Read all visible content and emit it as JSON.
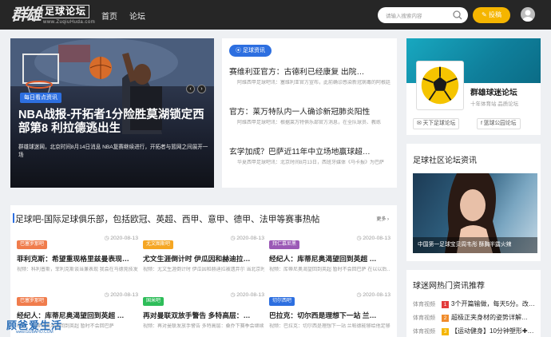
{
  "header": {
    "logo_big": "群雄",
    "logo_box": "足球论坛",
    "logo_sub": "www.ZuqiuHuda.com",
    "nav": [
      "首页",
      "论坛"
    ],
    "search_placeholder": "请输入搜索内容",
    "contribute": "投稿"
  },
  "hero": {
    "tag": "每日看点资讯",
    "title": "NBA战报-开拓者1分险胜莫湖锁定西部第8 利拉德逃出生",
    "caption": "群雄球迷网，北京时间8月14日消息 NBA复赛继续进行，开拓者与篮网之间展开一场",
    "prev": "‹",
    "next": "›"
  },
  "news": {
    "pill": "足球资讯",
    "items": [
      {
        "title": "赛维利亚官方：古德利已经康复 出院…",
        "desc": "阿维西甲足球吧讯：塞维利亚官方宣布，此前确诊感染新冠病毒的阿根廷"
      },
      {
        "title": "官方：莱万特队内一人确诊新冠肺炎阳性",
        "desc": "阿维西甲足球吧讯：根据莱万特俱乐部官方消息，在全队球员、教练"
      },
      {
        "title": "玄学加成？巴萨近11年中立场地赢球超…",
        "desc": "华夏西甲足球吧讯：北京时间8月13日，西班牙媒体《马卡报》为巴萨"
      }
    ]
  },
  "forum": {
    "name": "群雄球迷论坛",
    "sub": "十年体育站 品质论坛",
    "btn1": "天下足球论坛",
    "btn2": "篮球公园论坛"
  },
  "community": {
    "heading": "足球社区论坛资讯",
    "caption": "中国第一足球宝贝周韦彤 酥胸半露火辣"
  },
  "hot": {
    "heading": "球迷网热门资讯推荐",
    "rows": [
      {
        "cat": "体育视频",
        "num": "1",
        "text": "3个开篇输做，每天5分。改…"
      },
      {
        "cat": "体育视频",
        "num": "2",
        "text": "超极正夹身材的姿势详解…"
      },
      {
        "cat": "体育视频",
        "num": "3",
        "text": "【运动健身】10分钟塑形✚…"
      }
    ],
    "num_colors": [
      "#e23c3c",
      "#f08c2c",
      "#f5b500"
    ]
  },
  "section": {
    "heading": "足球吧-国际足球俱乐部，包括欧冠、英超、西甲、意甲、德甲、法甲等赛事热帖",
    "more": "更多 ›",
    "cells": [
      {
        "tag": "巴塞罗那吧",
        "tag_color": "#f07c4c",
        "date": "2020-08-13",
        "title": "菲利克斯：希望重现格里兹曼表现…",
        "desc": "视频：科利普斯，菲利克斯谈当兼表现 我会在马德竞技发起新的…"
      },
      {
        "tag": "尤文图斯吧",
        "tag_color": "#f5a623",
        "date": "2020-08-13",
        "title": "尤文生涯倒计时 伊瓜因和赫迪拉…",
        "desc": "视频：尤文生涯倒计时 伊瓜因和赫迪拉被遗弃尔 当北京时间…"
      },
      {
        "tag": "拜仁慕尼黑",
        "tag_color": "#9b59b6",
        "date": "2020-08-13",
        "title": "经纪人：库蒂尼奥渴望回到英超 …",
        "desc": "视频：库蒂尼奥渴望回到英超 暂时不会回巴萨 在以以后…"
      },
      {
        "tag": "巴塞罗那吧",
        "tag_color": "#f07c4c",
        "date": "2020-08-13",
        "title": "经纪人：库蒂尼奥渴望回到英超 …",
        "desc": "视频：库蒂尼奥渴望回到英超 暂时不会回巴萨"
      },
      {
        "tag": "国米吧",
        "tag_color": "#2ebd59",
        "date": "2020-08-13",
        "title": "再对曼联双放手警告 多特高层：…",
        "desc": "视频：再对曼联发放手警告 多特高层：桑乔下赛季会继续留在多特…"
      },
      {
        "tag": "切尔西吧",
        "tag_color": "#2d6fe0",
        "date": "2020-08-13",
        "title": "巴拉克：切尔西是理想下一站 兰…",
        "desc": "视频：巴拉克：切尔西是理想下一站 兰帕德能够给他足够…"
      }
    ]
  },
  "watermark": {
    "title": "顾爸爱生活",
    "sub": "www.GUBAHO.COM"
  }
}
